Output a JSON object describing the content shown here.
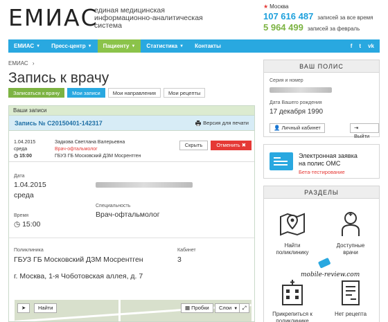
{
  "header": {
    "logo": "ЕМИАС",
    "logo_desc": "единая медицинская информационно-аналитическая система",
    "city": "Москва",
    "stat_total_value": "107 616 487",
    "stat_total_label": "записей за все время",
    "stat_month_value": "5 964 499",
    "stat_month_label": "записей за февраль"
  },
  "nav": {
    "items": [
      {
        "label": "ЕМИАС"
      },
      {
        "label": "Пресс-центр"
      },
      {
        "label": "Пациенту"
      },
      {
        "label": "Статистика"
      },
      {
        "label": "Контакты"
      }
    ],
    "social": [
      "f",
      "t",
      "vk"
    ]
  },
  "breadcrumb": "ЕМИАС",
  "page_title": "Запись к врачу",
  "tabs": [
    {
      "label": "Записаться к врачу"
    },
    {
      "label": "Мои записи"
    },
    {
      "label": "Мои направления"
    },
    {
      "label": "Мои рецепты"
    }
  ],
  "panel": {
    "header": "Ваши записи",
    "record_title": "Запись № С20150401-142317",
    "print_label": "Версия для печати",
    "record_date": "1.04.2015",
    "record_day": "среда",
    "record_time": "15:00",
    "doctor_name": "Задкова Светлана Валерьевна",
    "doctor_spec": "Врач-офтальмолог",
    "clinic_short": "ГБУЗ ГБ Московский ДЗМ Мосрентген",
    "hide_label": "Скрыть",
    "cancel_label": "Отменить"
  },
  "details": {
    "date_label": "Дата",
    "date_value": "1.04.2015",
    "day_value": "среда",
    "time_label": "Время",
    "time_value": "15:00",
    "spec_label": "Специальность",
    "spec_value": "Врач-офтальмолог",
    "clinic_label": "Поликлиника",
    "clinic_value": "ГБУЗ ГБ Московский ДЗМ Мосрентген",
    "cabinet_label": "Кабинет",
    "cabinet_value": "3",
    "address_value": "г. Москва, 1-я Чоботовская аллея, д. 7"
  },
  "map": {
    "find_label": "Найти",
    "traffic_label": "Пробки",
    "layers_label": "Слои"
  },
  "policy": {
    "title": "ВАШ ПОЛИС",
    "series_label": "Серия и номер",
    "dob_label": "Дата Вашего рождения",
    "dob_value": "17 декабря 1990",
    "cabinet_btn": "Личный кабинет",
    "exit_btn": "Выйти"
  },
  "oms": {
    "line1": "Электронная заявка",
    "line2": "на полис ОМС",
    "tag": "Бета-тестирование"
  },
  "sections": {
    "title": "РАЗДЕЛЫ",
    "items": [
      {
        "label": "Найти поликлинику"
      },
      {
        "label": "Доступные врачи"
      },
      {
        "label": "Прикрепиться к поликлинике"
      },
      {
        "label": "Нет рецепта"
      }
    ]
  },
  "watermark": "mobile-review.com",
  "colors": {
    "accent_blue": "#29a8e0",
    "accent_green": "#7cb342",
    "danger": "#e53935"
  }
}
